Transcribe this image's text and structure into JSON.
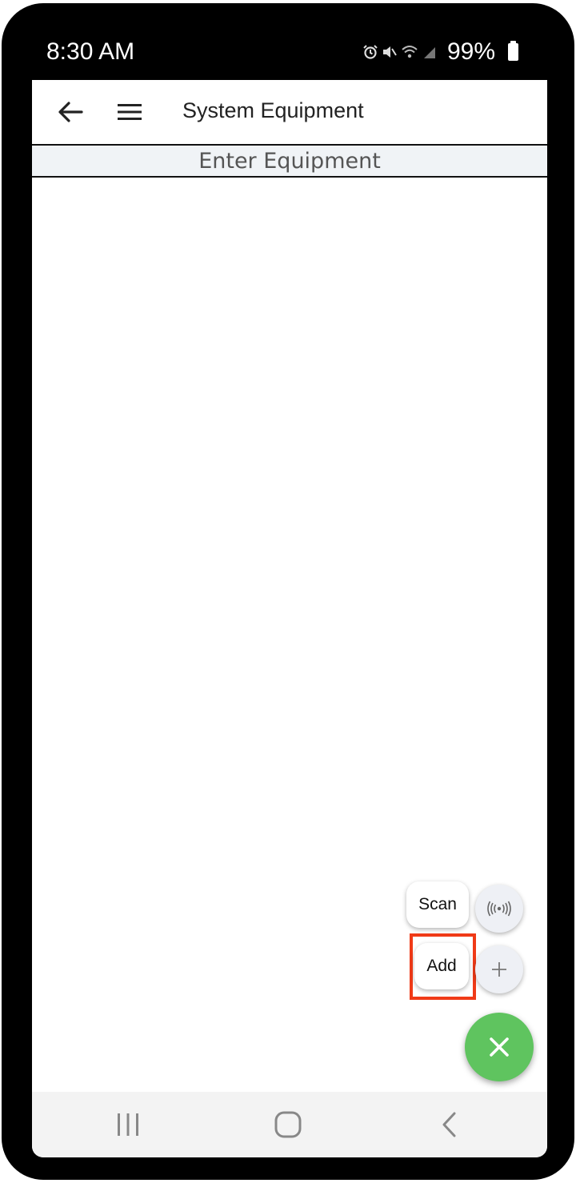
{
  "status_bar": {
    "time": "8:30 AM",
    "battery": "99%",
    "icons": [
      "alarm-icon",
      "mute-icon",
      "wifi-icon",
      "signal-icon",
      "battery-icon"
    ]
  },
  "app_bar": {
    "title": "System Equipment",
    "back_icon": "arrow-left-icon",
    "menu_icon": "hamburger-menu-icon"
  },
  "sub_header": {
    "text": "Enter Equipment"
  },
  "speed_dial": {
    "actions": [
      {
        "label": "Scan",
        "icon": "nfc-scan-icon"
      },
      {
        "label": "Add",
        "icon": "plus-icon"
      }
    ],
    "main_icon": "close-icon",
    "main_color": "#5fc45f",
    "highlight_color": "#f03a17"
  },
  "nav_bar": {
    "icons": [
      "recent-apps-icon",
      "home-icon",
      "back-icon"
    ]
  }
}
